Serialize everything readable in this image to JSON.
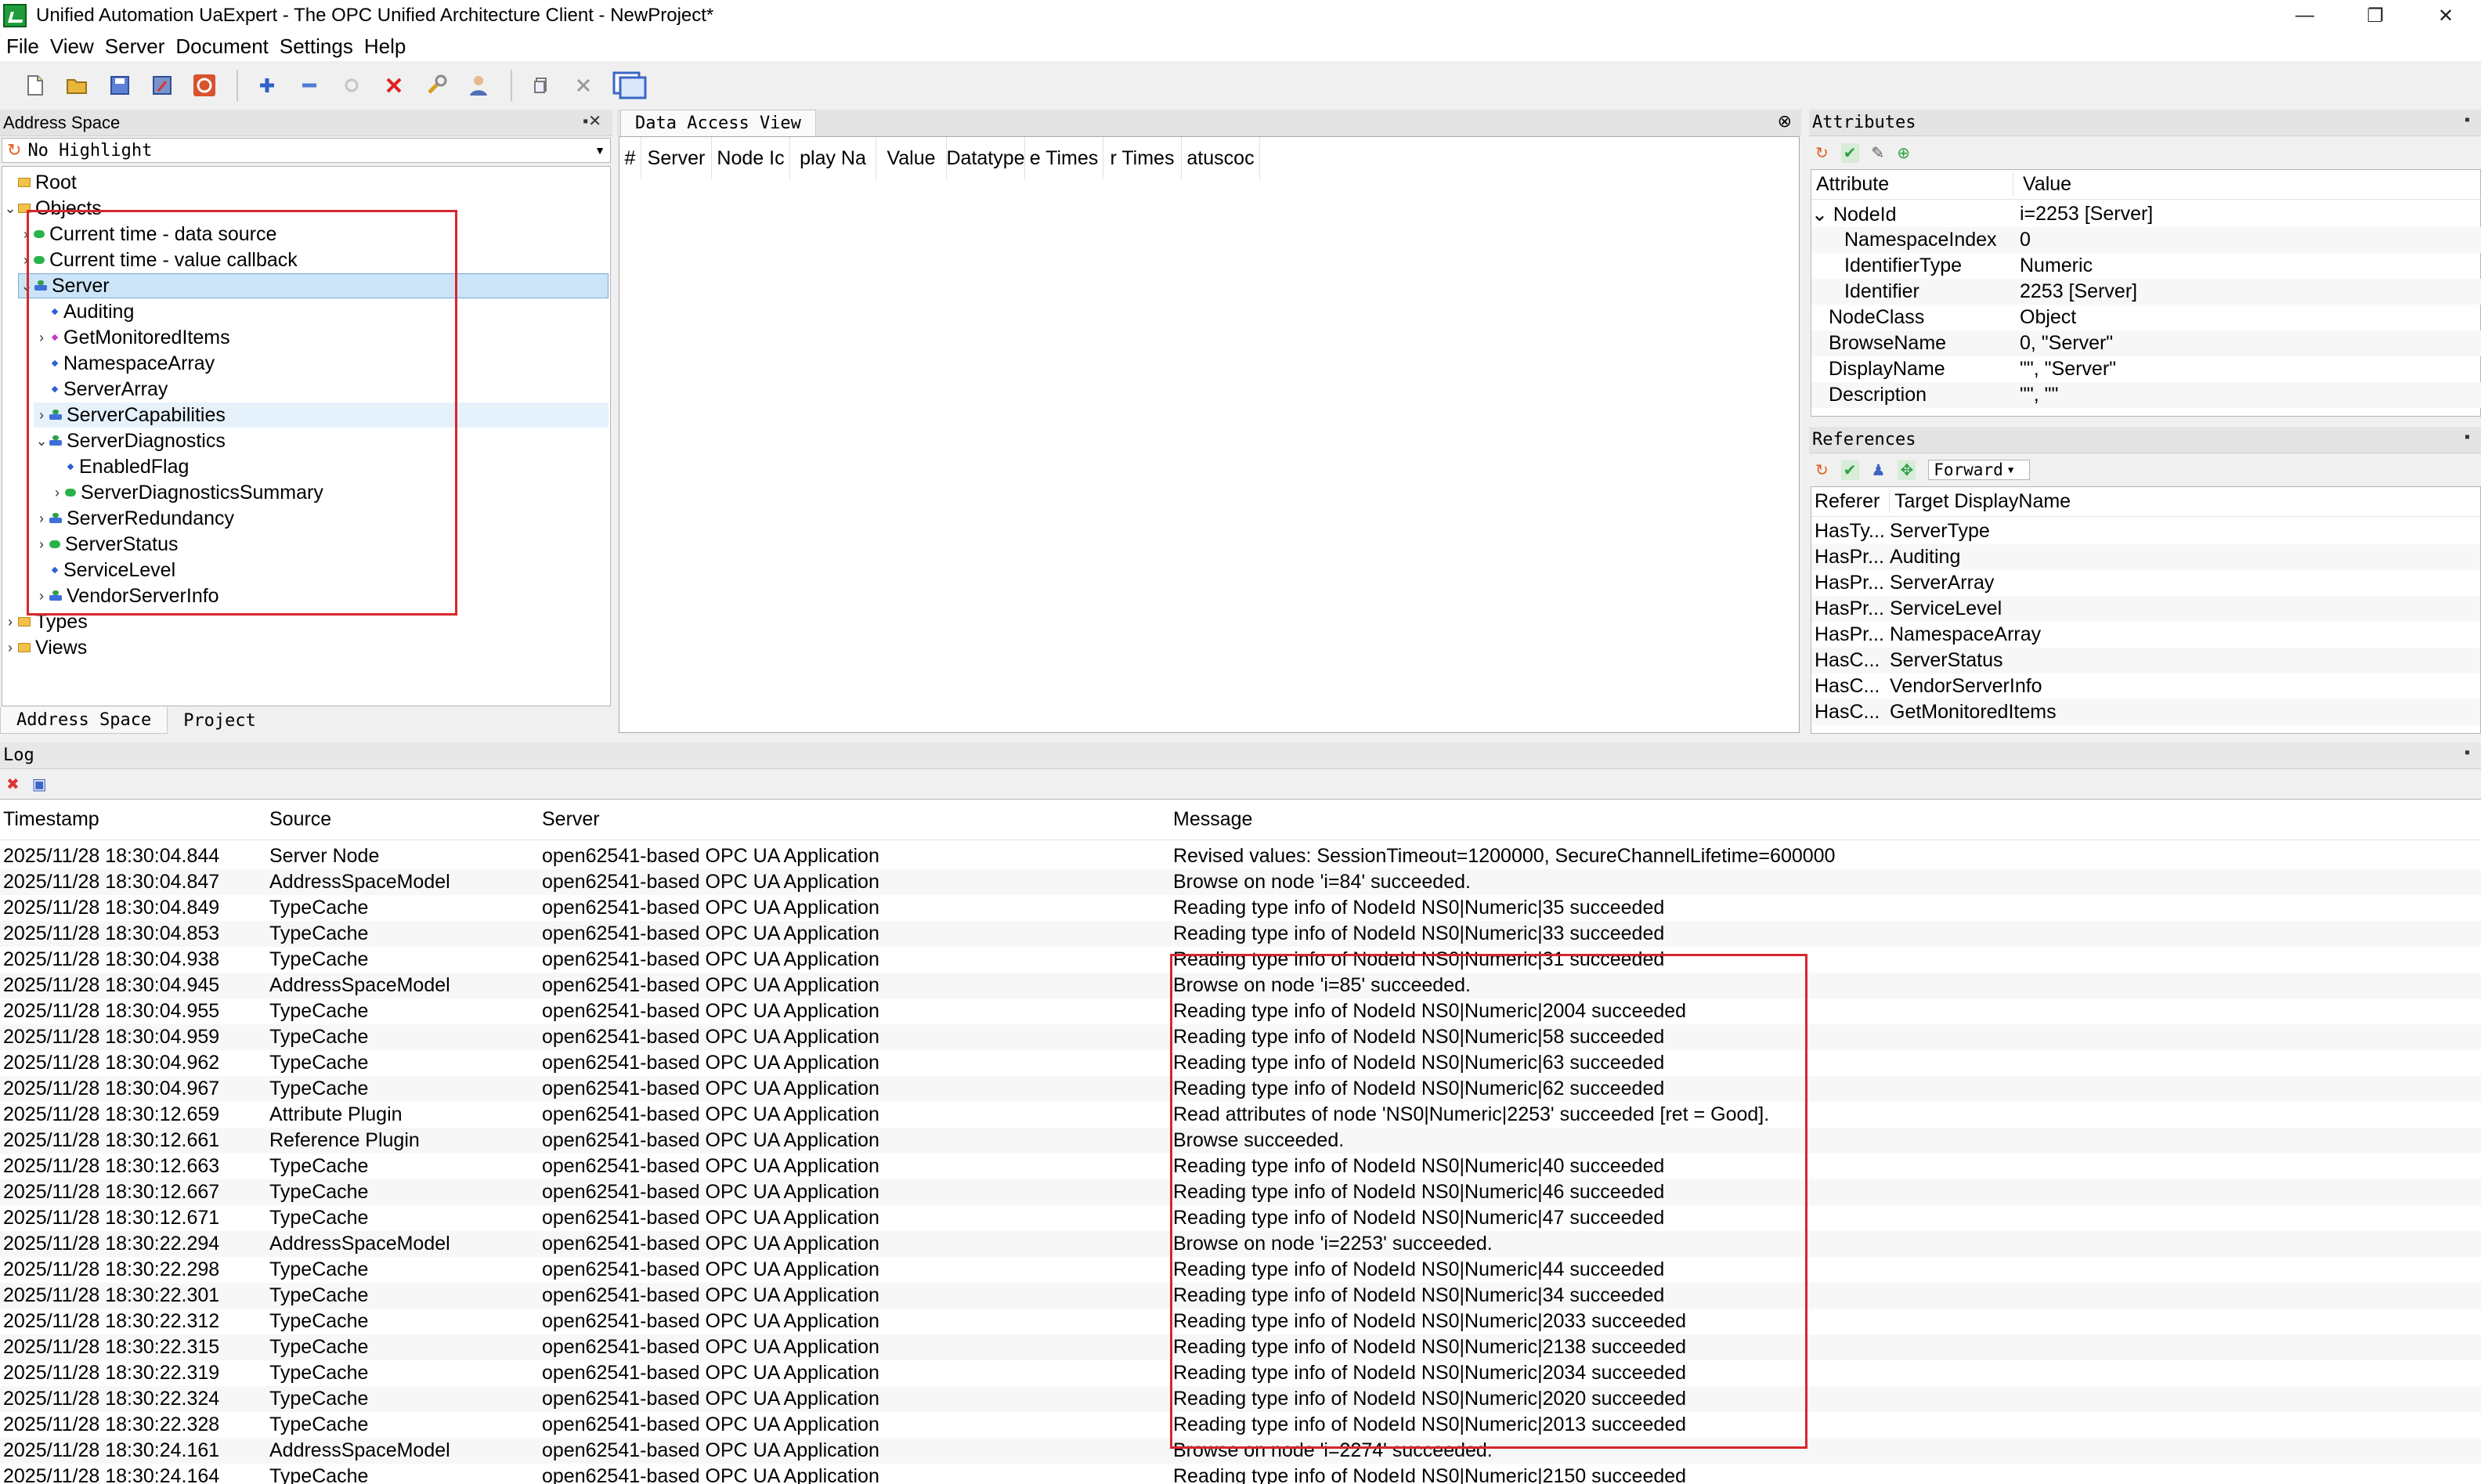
{
  "window": {
    "title": "Unified Automation UaExpert - The OPC Unified Architecture Client - NewProject*",
    "controls": [
      "—",
      "❐",
      "✕"
    ]
  },
  "menu": [
    "File",
    "View",
    "Server",
    "Document",
    "Settings",
    "Help"
  ],
  "toolbar": {
    "icons": [
      "new-document-icon",
      "open-folder-icon",
      "save-icon",
      "save-as-icon",
      "stop-icon",
      "add-server-icon",
      "remove-server-icon",
      "reconnect-icon",
      "disconnect-icon",
      "settings-wrench-icon",
      "user-icon",
      "copy-icon",
      "cut-icon",
      "view-window-icon"
    ]
  },
  "address_space": {
    "header": "Address Space",
    "filter": "No Highlight",
    "tabs": [
      "Address Space",
      "Project"
    ],
    "tree": [
      {
        "label": "Root",
        "icon": "folder",
        "depth": 0,
        "exp": ""
      },
      {
        "label": "Objects",
        "icon": "folder",
        "depth": 0,
        "exp": "v"
      },
      {
        "label": "Current time - data source",
        "icon": "object",
        "depth": 1,
        "exp": ">"
      },
      {
        "label": "Current time - value callback",
        "icon": "object",
        "depth": 1,
        "exp": ">"
      },
      {
        "label": "Server",
        "icon": "server",
        "depth": 1,
        "exp": "v",
        "selected": true
      },
      {
        "label": "Auditing",
        "icon": "variable",
        "depth": 2,
        "exp": ""
      },
      {
        "label": "GetMonitoredItems",
        "icon": "method",
        "depth": 2,
        "exp": ">"
      },
      {
        "label": "NamespaceArray",
        "icon": "variable",
        "depth": 2,
        "exp": ""
      },
      {
        "label": "ServerArray",
        "icon": "variable",
        "depth": 2,
        "exp": ""
      },
      {
        "label": "ServerCapabilities",
        "icon": "server",
        "depth": 2,
        "exp": ">",
        "hover": true
      },
      {
        "label": "ServerDiagnostics",
        "icon": "server",
        "depth": 2,
        "exp": "v"
      },
      {
        "label": "EnabledFlag",
        "icon": "variable",
        "depth": 3,
        "exp": ""
      },
      {
        "label": "ServerDiagnosticsSummary",
        "icon": "object",
        "depth": 3,
        "exp": ">"
      },
      {
        "label": "ServerRedundancy",
        "icon": "server",
        "depth": 2,
        "exp": ">"
      },
      {
        "label": "ServerStatus",
        "icon": "object",
        "depth": 2,
        "exp": ">"
      },
      {
        "label": "ServiceLevel",
        "icon": "variable",
        "depth": 2,
        "exp": ""
      },
      {
        "label": "VendorServerInfo",
        "icon": "server",
        "depth": 2,
        "exp": ">"
      },
      {
        "label": "Types",
        "icon": "folder",
        "depth": 0,
        "exp": ">"
      },
      {
        "label": "Views",
        "icon": "folder",
        "depth": 0,
        "exp": ">"
      }
    ]
  },
  "data_access_view": {
    "tab": "Data Access View",
    "columns": [
      "#",
      "Server",
      "Node Ic",
      "play Na",
      "Value",
      "Datatype",
      "e Times",
      "r Times",
      "atuscoc"
    ]
  },
  "attributes": {
    "header": "Attributes",
    "columns": [
      "Attribute",
      "Value"
    ],
    "rows": [
      {
        "k": "NodeId",
        "v": "i=2253 [Server]",
        "exp": "v",
        "indent": 0
      },
      {
        "k": "NamespaceIndex",
        "v": "0",
        "exp": "",
        "indent": 1
      },
      {
        "k": "IdentifierType",
        "v": "Numeric",
        "exp": "",
        "indent": 1
      },
      {
        "k": "Identifier",
        "v": "2253 [Server]",
        "exp": "",
        "indent": 1
      },
      {
        "k": "NodeClass",
        "v": "Object",
        "exp": "",
        "indent": 0
      },
      {
        "k": "BrowseName",
        "v": "0, \"Server\"",
        "exp": "",
        "indent": 0
      },
      {
        "k": "DisplayName",
        "v": "\"\", \"Server\"",
        "exp": "",
        "indent": 0
      },
      {
        "k": "Description",
        "v": "\"\", \"\"",
        "exp": "",
        "indent": 0
      }
    ]
  },
  "references": {
    "header": "References",
    "direction": "Forward",
    "columns": [
      "Referer",
      "Target DisplayName"
    ],
    "rows": [
      {
        "t": "HasTy...",
        "n": "ServerType"
      },
      {
        "t": "HasPr...",
        "n": "Auditing"
      },
      {
        "t": "HasPr...",
        "n": "ServerArray"
      },
      {
        "t": "HasPr...",
        "n": "ServiceLevel"
      },
      {
        "t": "HasPr...",
        "n": "NamespaceArray"
      },
      {
        "t": "HasC...",
        "n": "ServerStatus"
      },
      {
        "t": "HasC...",
        "n": "VendorServerInfo"
      },
      {
        "t": "HasC...",
        "n": "GetMonitoredItems"
      }
    ]
  },
  "log": {
    "header": "Log",
    "columns": [
      "Timestamp",
      "Source",
      "Server",
      "Message"
    ],
    "rows": [
      [
        "2025/11/28 18:30:04.844",
        "Server Node",
        "open62541-based OPC UA Application",
        "Revised values: SessionTimeout=1200000, SecureChannelLifetime=600000"
      ],
      [
        "2025/11/28 18:30:04.847",
        "AddressSpaceModel",
        "open62541-based OPC UA Application",
        "Browse on node 'i=84' succeeded."
      ],
      [
        "2025/11/28 18:30:04.849",
        "TypeCache",
        "open62541-based OPC UA Application",
        "Reading type info of NodeId NS0|Numeric|35 succeeded"
      ],
      [
        "2025/11/28 18:30:04.853",
        "TypeCache",
        "open62541-based OPC UA Application",
        "Reading type info of NodeId NS0|Numeric|33 succeeded"
      ],
      [
        "2025/11/28 18:30:04.938",
        "TypeCache",
        "open62541-based OPC UA Application",
        "Reading type info of NodeId NS0|Numeric|31 succeeded"
      ],
      [
        "2025/11/28 18:30:04.945",
        "AddressSpaceModel",
        "open62541-based OPC UA Application",
        "Browse on node 'i=85' succeeded."
      ],
      [
        "2025/11/28 18:30:04.955",
        "TypeCache",
        "open62541-based OPC UA Application",
        "Reading type info of NodeId NS0|Numeric|2004 succeeded"
      ],
      [
        "2025/11/28 18:30:04.959",
        "TypeCache",
        "open62541-based OPC UA Application",
        "Reading type info of NodeId NS0|Numeric|58 succeeded"
      ],
      [
        "2025/11/28 18:30:04.962",
        "TypeCache",
        "open62541-based OPC UA Application",
        "Reading type info of NodeId NS0|Numeric|63 succeeded"
      ],
      [
        "2025/11/28 18:30:04.967",
        "TypeCache",
        "open62541-based OPC UA Application",
        "Reading type info of NodeId NS0|Numeric|62 succeeded"
      ],
      [
        "2025/11/28 18:30:12.659",
        "Attribute Plugin",
        "open62541-based OPC UA Application",
        "Read attributes of node 'NS0|Numeric|2253' succeeded [ret = Good]."
      ],
      [
        "2025/11/28 18:30:12.661",
        "Reference Plugin",
        "open62541-based OPC UA Application",
        "Browse succeeded."
      ],
      [
        "2025/11/28 18:30:12.663",
        "TypeCache",
        "open62541-based OPC UA Application",
        "Reading type info of NodeId NS0|Numeric|40 succeeded"
      ],
      [
        "2025/11/28 18:30:12.667",
        "TypeCache",
        "open62541-based OPC UA Application",
        "Reading type info of NodeId NS0|Numeric|46 succeeded"
      ],
      [
        "2025/11/28 18:30:12.671",
        "TypeCache",
        "open62541-based OPC UA Application",
        "Reading type info of NodeId NS0|Numeric|47 succeeded"
      ],
      [
        "2025/11/28 18:30:22.294",
        "AddressSpaceModel",
        "open62541-based OPC UA Application",
        "Browse on node 'i=2253' succeeded."
      ],
      [
        "2025/11/28 18:30:22.298",
        "TypeCache",
        "open62541-based OPC UA Application",
        "Reading type info of NodeId NS0|Numeric|44 succeeded"
      ],
      [
        "2025/11/28 18:30:22.301",
        "TypeCache",
        "open62541-based OPC UA Application",
        "Reading type info of NodeId NS0|Numeric|34 succeeded"
      ],
      [
        "2025/11/28 18:30:22.312",
        "TypeCache",
        "open62541-based OPC UA Application",
        "Reading type info of NodeId NS0|Numeric|2033 succeeded"
      ],
      [
        "2025/11/28 18:30:22.315",
        "TypeCache",
        "open62541-based OPC UA Application",
        "Reading type info of NodeId NS0|Numeric|2138 succeeded"
      ],
      [
        "2025/11/28 18:30:22.319",
        "TypeCache",
        "open62541-based OPC UA Application",
        "Reading type info of NodeId NS0|Numeric|2034 succeeded"
      ],
      [
        "2025/11/28 18:30:22.324",
        "TypeCache",
        "open62541-based OPC UA Application",
        "Reading type info of NodeId NS0|Numeric|2020 succeeded"
      ],
      [
        "2025/11/28 18:30:22.328",
        "TypeCache",
        "open62541-based OPC UA Application",
        "Reading type info of NodeId NS0|Numeric|2013 succeeded"
      ],
      [
        "2025/11/28 18:30:24.161",
        "AddressSpaceModel",
        "open62541-based OPC UA Application",
        "Browse on node 'i=2274' succeeded."
      ],
      [
        "2025/11/28 18:30:24.164",
        "TypeCache",
        "open62541-based OPC UA Application",
        "Reading type info of NodeId NS0|Numeric|2150 succeeded"
      ]
    ]
  },
  "colors": {
    "highlight_box": "#d7262e",
    "selection": "#cce4f7"
  }
}
